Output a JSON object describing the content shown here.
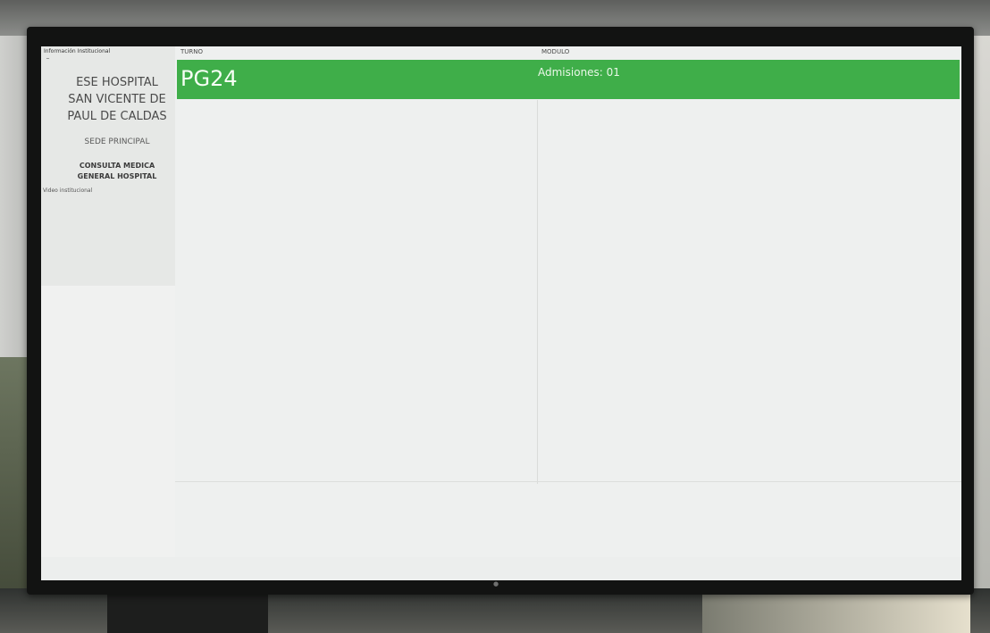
{
  "sidebar": {
    "title": "Información Institucional",
    "hospital_name": [
      "ESE HOSPITAL",
      "SAN VICENTE DE",
      "PAUL DE CALDAS"
    ],
    "sede": "SEDE PRINCIPAL",
    "consulta": [
      "CONSULTA MEDICA",
      "GENERAL HOSPITAL"
    ],
    "video_label": "Video institucional"
  },
  "table": {
    "turno_header": "TURNO",
    "modulo_header": "MODULO",
    "rows": [
      {
        "turno": "PG24",
        "modulo": "Admisiones: 01"
      }
    ]
  },
  "colors": {
    "active_row": "#3fae49"
  }
}
